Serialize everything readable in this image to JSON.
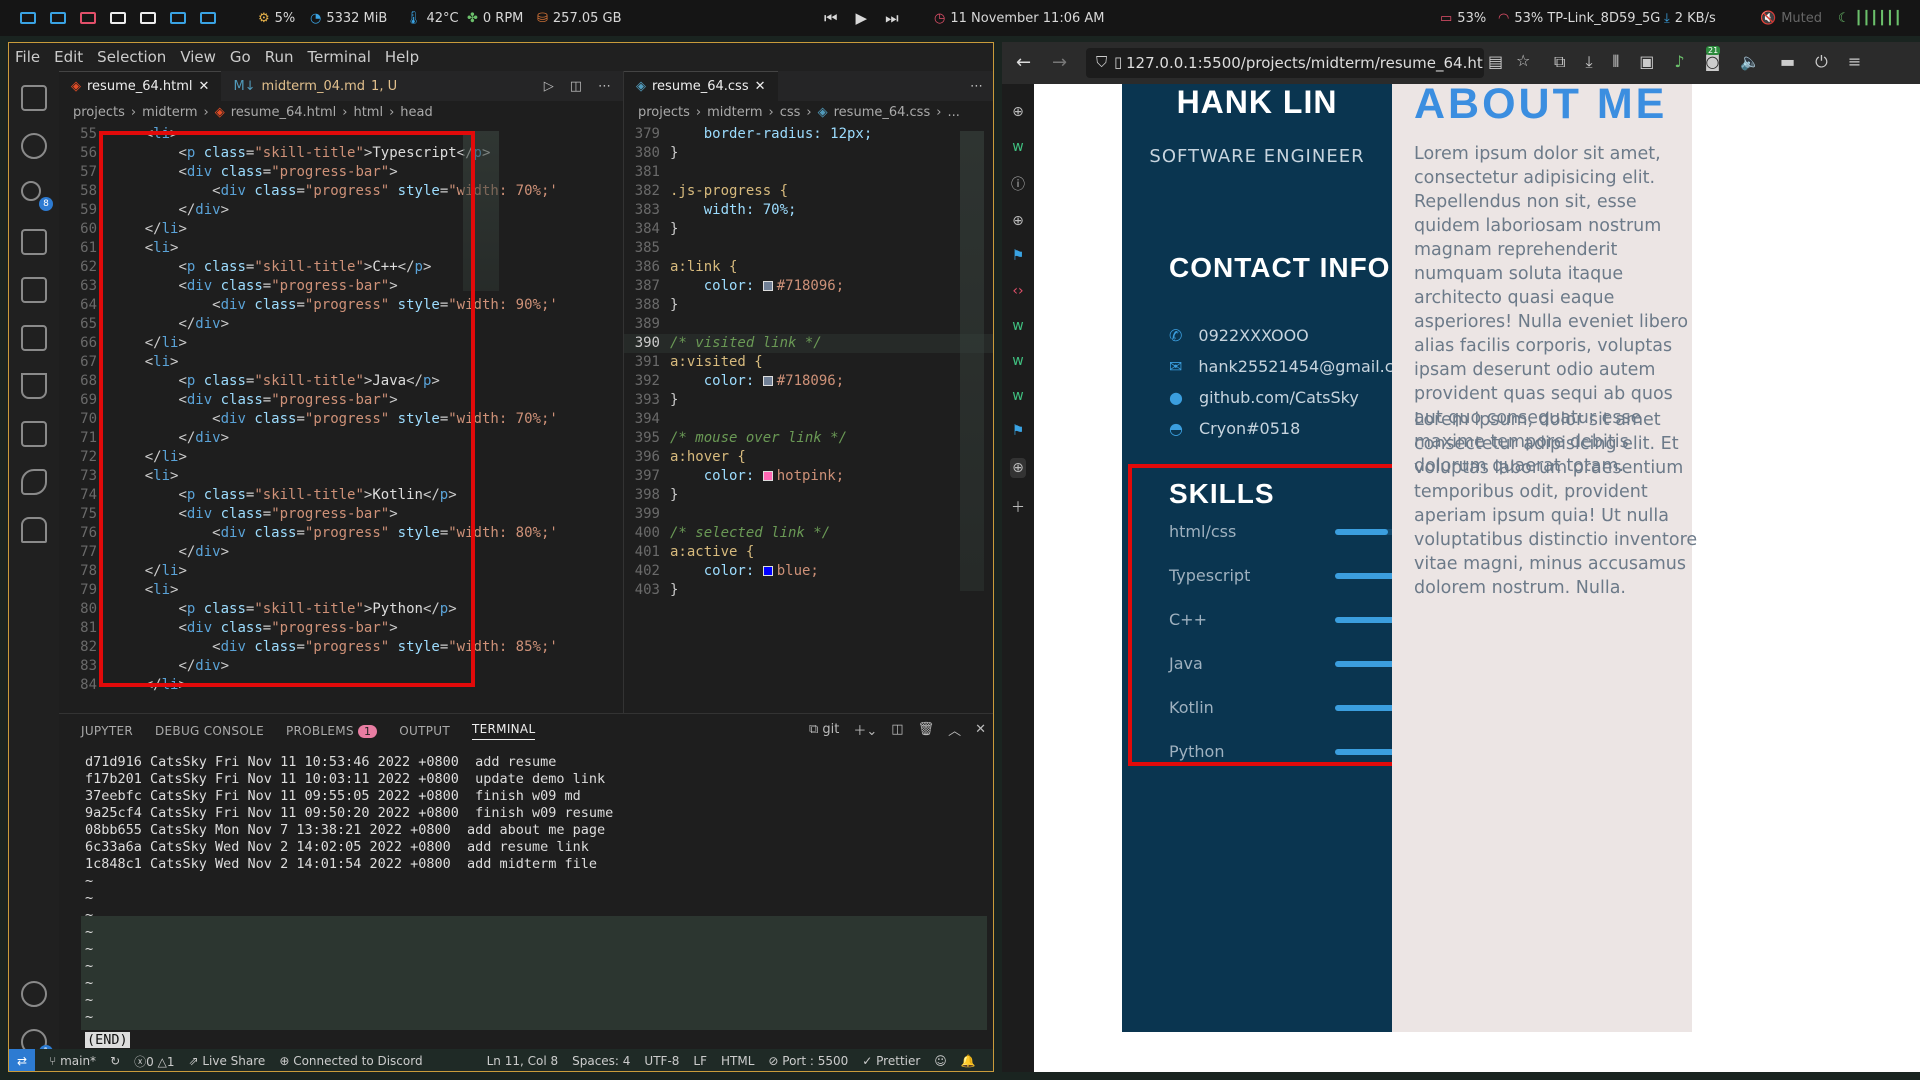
{
  "topbar": {
    "cpu": "5%",
    "mem": "5332 MiB",
    "temp": "42°C",
    "fan": "0 RPM",
    "disk": "257.05 GB",
    "clock": "11 November 11:06 AM",
    "battery": "53%",
    "wifi": "53% TP-Link_8D59_5G",
    "net": "2 KB/s",
    "volume": "Muted"
  },
  "vscode": {
    "menu": [
      "File",
      "Edit",
      "Selection",
      "View",
      "Go",
      "Run",
      "Terminal",
      "Help"
    ],
    "tabs": {
      "html": "resume_64.html",
      "md": "midterm_04.md",
      "md_badge": "1, U",
      "css": "resume_64.css"
    },
    "breadcrumb_html": [
      "projects",
      "midterm",
      "resume_64.html",
      "html",
      "head"
    ],
    "breadcrumb_css": [
      "projects",
      "midterm",
      "css",
      "resume_64.css",
      "..."
    ],
    "html_lines": [
      {
        "n": "55",
        "i": 1,
        "k": "open",
        "tag": "li"
      },
      {
        "n": "56",
        "i": 2,
        "k": "p",
        "text": "Typescript"
      },
      {
        "n": "57",
        "i": 2,
        "k": "div",
        "cls": "progress-bar"
      },
      {
        "n": "58",
        "i": 3,
        "k": "prog",
        "w": "width: 70%;"
      },
      {
        "n": "59",
        "i": 2,
        "k": "close",
        "tag": "div"
      },
      {
        "n": "60",
        "i": 1,
        "k": "close",
        "tag": "li"
      },
      {
        "n": "61",
        "i": 1,
        "k": "open",
        "tag": "li"
      },
      {
        "n": "62",
        "i": 2,
        "k": "p",
        "text": "C++"
      },
      {
        "n": "63",
        "i": 2,
        "k": "div",
        "cls": "progress-bar"
      },
      {
        "n": "64",
        "i": 3,
        "k": "prog",
        "w": "width: 90%;"
      },
      {
        "n": "65",
        "i": 2,
        "k": "close",
        "tag": "div"
      },
      {
        "n": "66",
        "i": 1,
        "k": "close",
        "tag": "li"
      },
      {
        "n": "67",
        "i": 1,
        "k": "open",
        "tag": "li"
      },
      {
        "n": "68",
        "i": 2,
        "k": "p",
        "text": "Java"
      },
      {
        "n": "69",
        "i": 2,
        "k": "div",
        "cls": "progress-bar"
      },
      {
        "n": "70",
        "i": 3,
        "k": "prog",
        "w": "width: 70%;"
      },
      {
        "n": "71",
        "i": 2,
        "k": "close",
        "tag": "div"
      },
      {
        "n": "72",
        "i": 1,
        "k": "close",
        "tag": "li"
      },
      {
        "n": "73",
        "i": 1,
        "k": "open",
        "tag": "li"
      },
      {
        "n": "74",
        "i": 2,
        "k": "p",
        "text": "Kotlin"
      },
      {
        "n": "75",
        "i": 2,
        "k": "div",
        "cls": "progress-bar"
      },
      {
        "n": "76",
        "i": 3,
        "k": "prog",
        "w": "width: 80%;"
      },
      {
        "n": "77",
        "i": 2,
        "k": "close",
        "tag": "div"
      },
      {
        "n": "78",
        "i": 1,
        "k": "close",
        "tag": "li"
      },
      {
        "n": "79",
        "i": 1,
        "k": "open",
        "tag": "li"
      },
      {
        "n": "80",
        "i": 2,
        "k": "p",
        "text": "Python"
      },
      {
        "n": "81",
        "i": 2,
        "k": "div",
        "cls": "progress-bar"
      },
      {
        "n": "82",
        "i": 3,
        "k": "prog",
        "w": "width: 85%;"
      },
      {
        "n": "83",
        "i": 2,
        "k": "close",
        "tag": "div"
      },
      {
        "n": "84",
        "i": 1,
        "k": "close",
        "tag": "li"
      }
    ],
    "css_lines": [
      {
        "n": "379",
        "t": "    border-radius: 12px;",
        "c": "pr"
      },
      {
        "n": "380",
        "t": "}",
        "c": "pu"
      },
      {
        "n": "381",
        "t": "",
        "c": "pu"
      },
      {
        "n": "382",
        "t": ".js-progress {",
        "c": "sel"
      },
      {
        "n": "383",
        "t": "    width: 70%;",
        "c": "pr"
      },
      {
        "n": "384",
        "t": "}",
        "c": "pu"
      },
      {
        "n": "385",
        "t": "",
        "c": "pu"
      },
      {
        "n": "386",
        "t": "a:link {",
        "c": "sel"
      },
      {
        "n": "387",
        "t": "    color: ",
        "c": "pr",
        "sw": "#718096",
        "v": "#718096;"
      },
      {
        "n": "388",
        "t": "}",
        "c": "pu"
      },
      {
        "n": "389",
        "t": "",
        "c": "pu"
      },
      {
        "n": "390",
        "t": "/* visited link */",
        "c": "cm"
      },
      {
        "n": "391",
        "t": "a:visited {",
        "c": "sel"
      },
      {
        "n": "392",
        "t": "    color: ",
        "c": "pr",
        "sw": "#718096",
        "v": "#718096;"
      },
      {
        "n": "393",
        "t": "}",
        "c": "pu"
      },
      {
        "n": "394",
        "t": "",
        "c": "pu"
      },
      {
        "n": "395",
        "t": "/* mouse over link */",
        "c": "cm"
      },
      {
        "n": "396",
        "t": "a:hover {",
        "c": "sel"
      },
      {
        "n": "397",
        "t": "    color: ",
        "c": "pr",
        "sw": "#ff69b4",
        "v": "hotpink;"
      },
      {
        "n": "398",
        "t": "}",
        "c": "pu"
      },
      {
        "n": "399",
        "t": "",
        "c": "pu"
      },
      {
        "n": "400",
        "t": "/* selected link */",
        "c": "cm"
      },
      {
        "n": "401",
        "t": "a:active {",
        "c": "sel"
      },
      {
        "n": "402",
        "t": "    color: ",
        "c": "pr",
        "sw": "#0000ff",
        "v": "blue;"
      },
      {
        "n": "403",
        "t": "}",
        "c": "pu"
      }
    ],
    "panel_tabs": [
      "JUPYTER",
      "DEBUG CONSOLE",
      "PROBLEMS",
      "OUTPUT",
      "TERMINAL"
    ],
    "problems_count": "1",
    "terminal_shell": "git",
    "terminal": [
      "d71d916 CatsSky Fri Nov 11 10:53:46 2022 +0800  add resume",
      "f17b201 CatsSky Fri Nov 11 10:03:11 2022 +0800  update demo link",
      "37eebfc CatsSky Fri Nov 11 09:55:05 2022 +0800  finish w09 md",
      "9a25cf4 CatsSky Fri Nov 11 09:50:20 2022 +0800  finish w09 resume",
      "08bb655 CatsSky Mon Nov 7 13:38:21 2022 +0800  add about me page",
      "6c33a6a CatsSky Wed Nov 2 14:02:05 2022 +0800  add resume link",
      "1c848c1 CatsSky Wed Nov 2 14:01:54 2022 +0800  add midterm file",
      "~",
      "~",
      "~",
      "~",
      "~",
      "~",
      "~",
      "~",
      "~"
    ],
    "terminal_end": "(END)",
    "status": {
      "branch": "main*",
      "errors": "0",
      "warnings": "1",
      "liveshare": "Live Share",
      "discord": "Connected to Discord",
      "pos": "Ln 11, Col 8",
      "spaces": "Spaces: 4",
      "enc": "UTF-8",
      "eol": "LF",
      "lang": "HTML",
      "port": "Port : 5500",
      "prettier": "Prettier"
    },
    "settings_badge": "1",
    "scm_badge": "8"
  },
  "browser": {
    "url": "127.0.0.1:5500/projects/midterm/resume_64.ht",
    "ext_badge": "21",
    "resume": {
      "name": "HANK LIN",
      "role": "SOFTWARE ENGINEER",
      "contact_heading": "CONTACT INFO",
      "contacts": [
        {
          "icon": "phone-icon",
          "text": "0922XXXOOO"
        },
        {
          "icon": "mail-icon",
          "text": "hank25521454@gmail.com"
        },
        {
          "icon": "github-icon",
          "text": "github.com/CatsSky"
        },
        {
          "icon": "discord-icon",
          "text": "Cryon#0518"
        }
      ],
      "skills_heading": "SKILLS",
      "skills": [
        {
          "name": "html/css",
          "level": 0.45
        },
        {
          "name": "Typescript",
          "level": 0.7
        },
        {
          "name": "C++",
          "level": 0.9
        },
        {
          "name": "Java",
          "level": 0.7
        },
        {
          "name": "Kotlin",
          "level": 0.8
        },
        {
          "name": "Python",
          "level": 0.85
        }
      ],
      "about_heading": "ABOUT ME",
      "about_p1": "Lorem ipsum dolor sit amet, consectetur adipisicing elit. Repellendus non sit, esse quidem laboriosam nostrum magnam reprehenderit numquam soluta itaque architecto quasi eaque asperiores! Nulla eveniet libero alias facilis corporis, voluptas ipsam deserunt odio autem provident quas sequi ab quos aut quo consequatur esse maxime tempore debitis dolorum quaerat totam.",
      "about_p2": "Lorem ipsum, dolor sit amet consectetur adipisicing elit. Et voluptas laborum praesentium temporibus odit, provident aperiam ipsum quia! Ut nulla voluptatibus distinctio inventore vitae magni, minus accusamus dolorem nostrum. Nulla."
    }
  }
}
